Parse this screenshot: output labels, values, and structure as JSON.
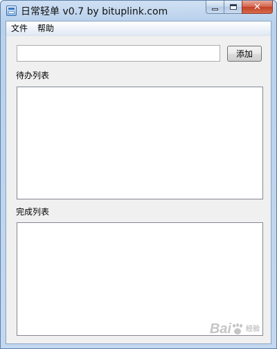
{
  "window": {
    "title": "日常轻单 v0.7 by bituplink.com",
    "icon": "app-icon",
    "controls": {
      "minimize": "minimize-icon",
      "maximize": "maximize-icon",
      "close": "✕"
    }
  },
  "menu": {
    "items": [
      {
        "label": "文件"
      },
      {
        "label": "帮助"
      }
    ]
  },
  "new_todo": {
    "value": "",
    "placeholder": "",
    "add_label": "添加"
  },
  "todo_section": {
    "label": "待办列表",
    "items": []
  },
  "done_section": {
    "label": "完成列表",
    "items": []
  },
  "watermark": {
    "brand_left": "Bai",
    "brand_right": "经验",
    "icon": "paw-icon"
  }
}
